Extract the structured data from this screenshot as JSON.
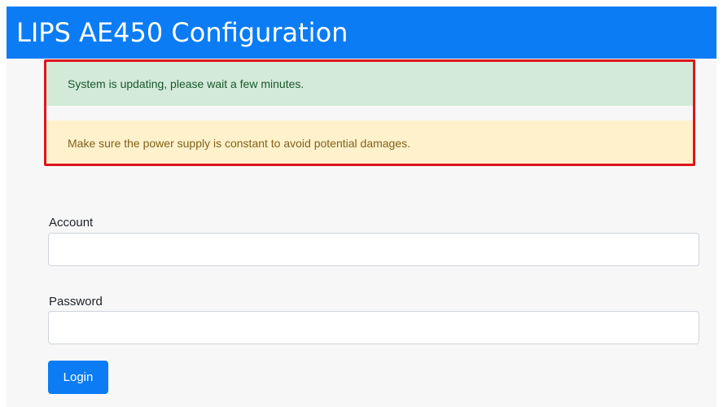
{
  "app": {
    "title": "LIPS AE450 Configuration"
  },
  "alerts": {
    "updating": "System is updating, please wait a few minutes.",
    "power_warning": "Make sure the power supply is constant to avoid potential damages."
  },
  "form": {
    "account_label": "Account",
    "account_value": "",
    "password_label": "Password",
    "password_value": "",
    "login_label": "Login"
  },
  "colors": {
    "brand_blue": "#0b7cf4",
    "highlight_border": "#e0141c",
    "success_background": "#d3ead9",
    "warning_background": "#fff1cc"
  }
}
